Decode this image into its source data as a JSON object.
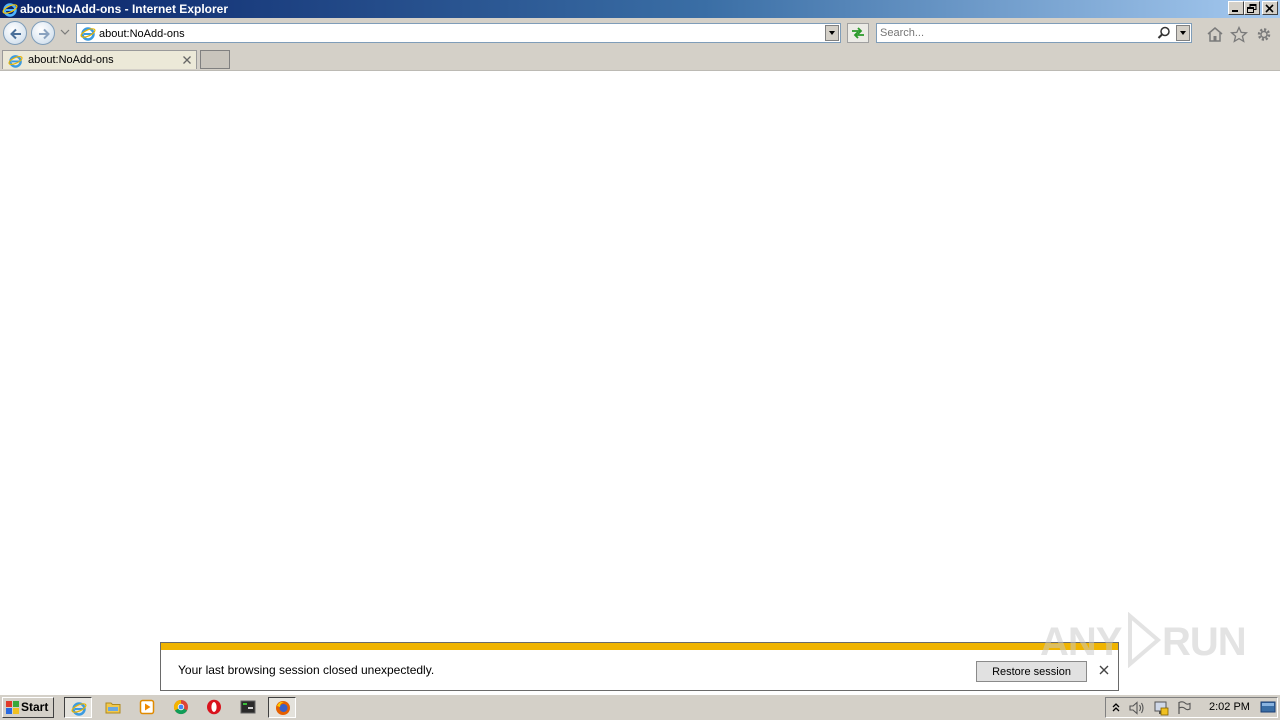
{
  "window": {
    "title": "about:NoAdd-ons - Internet Explorer"
  },
  "nav": {
    "address": "about:NoAdd-ons",
    "search_placeholder": "Search..."
  },
  "tabs": [
    {
      "label": "about:NoAdd-ons",
      "active": true
    }
  ],
  "notification": {
    "message": "Your last browsing session closed unexpectedly.",
    "button_label": "Restore session",
    "accent_color": "#f0b400"
  },
  "watermark": {
    "left": "ANY",
    "right": "RUN"
  },
  "taskbar": {
    "start_label": "Start",
    "pinned": [
      "internet-explorer-icon",
      "explorer-folder-icon",
      "media-player-icon",
      "chrome-icon",
      "opera-icon",
      "terminal-icon",
      "firefox-icon"
    ],
    "clock": "2:02 PM"
  },
  "colors": {
    "titlebar_start": "#0a246a",
    "titlebar_end": "#a6caf0",
    "chrome": "#d4d0c8"
  }
}
